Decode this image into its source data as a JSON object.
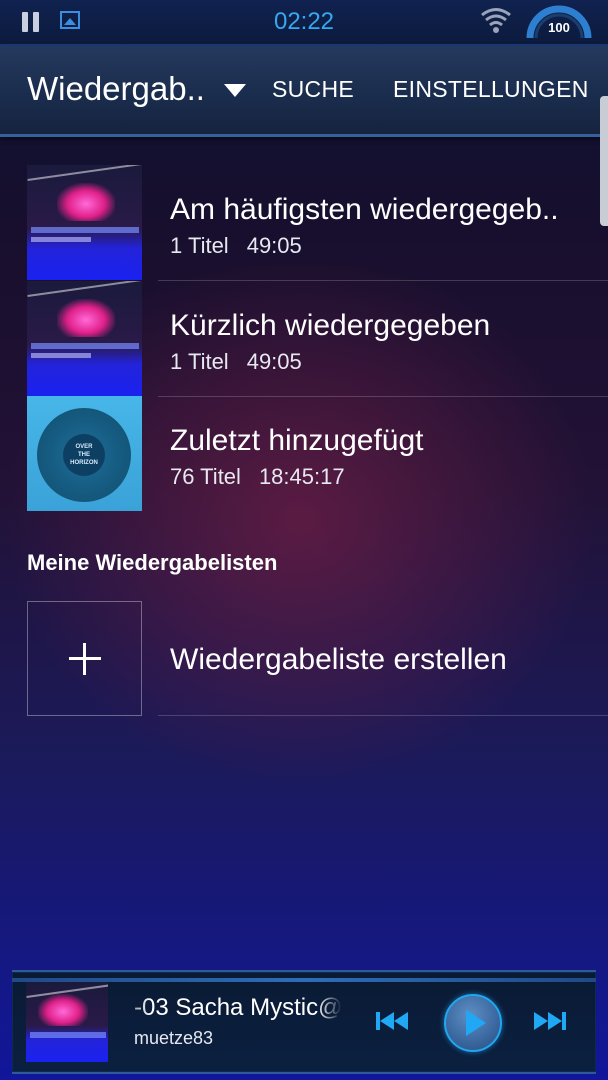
{
  "status_bar": {
    "time": "02:22",
    "battery_level": "100",
    "icons": [
      "pause-icon",
      "gallery-icon",
      "wifi-icon",
      "battery-gauge-icon"
    ],
    "accent_color": "#35a8f0"
  },
  "action_bar": {
    "title": "Wiedergab..",
    "search_label": "SUCHE",
    "settings_label": "EINSTELLUNGEN"
  },
  "auto_playlists": [
    {
      "title": "Am häufigsten wiedergegeb..",
      "count": "1 Titel",
      "duration": "49:05",
      "art": "pink-concert-art"
    },
    {
      "title": "Kürzlich wiedergegeben",
      "count": "1 Titel",
      "duration": "49:05",
      "art": "pink-concert-art"
    },
    {
      "title": "Zuletzt hinzugefügt",
      "count": "76 Titel",
      "duration": "18:45:17",
      "art": "vinyl-art"
    }
  ],
  "my_playlists": {
    "heading": "Meine Wiedergabelisten",
    "create_label": "Wiedergabeliste erstellen"
  },
  "vinyl_label": [
    "OVER",
    "THE",
    "HORIZON"
  ],
  "player": {
    "title": "-03 Sacha Mystic@",
    "artist": "muetze83",
    "controls": [
      "previous-icon",
      "play-icon",
      "next-icon"
    ],
    "control_color": "#20a8f4"
  }
}
